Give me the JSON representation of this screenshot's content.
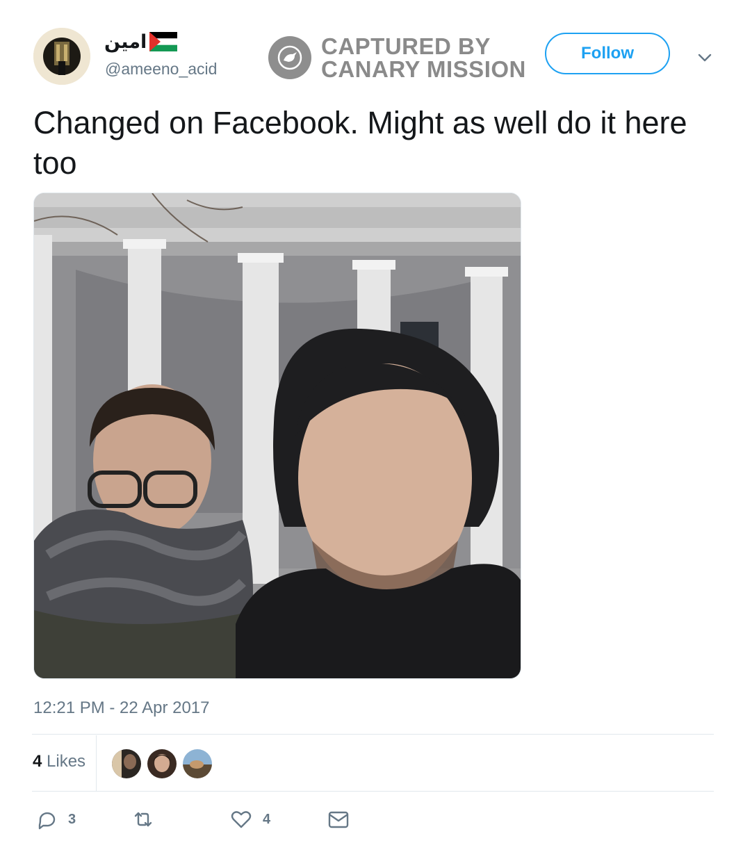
{
  "tweet": {
    "display_name": "امين",
    "handle": "@ameeno_acid",
    "text": "Changed on Facebook. Might as well do it here too",
    "timestamp": "12:21 PM - 22 Apr 2017"
  },
  "watermark": {
    "line1": "CAPTURED BY",
    "line2": "CANARY MISSION"
  },
  "follow_button": {
    "label": "Follow"
  },
  "stats": {
    "likes_count": "4",
    "likes_word": "Likes"
  },
  "actions": {
    "reply_count": "3",
    "retweet_count": "",
    "like_count": "4"
  },
  "colors": {
    "accent": "#1da1f2",
    "muted": "#657786",
    "divider": "#e1e8ed",
    "watermark": "#8a8a8a"
  },
  "icons": [
    "avatar-photo",
    "palestine-flag-icon",
    "canary-bird-icon",
    "chevron-down-icon",
    "reply-icon",
    "retweet-icon",
    "heart-icon",
    "direct-message-icon"
  ]
}
